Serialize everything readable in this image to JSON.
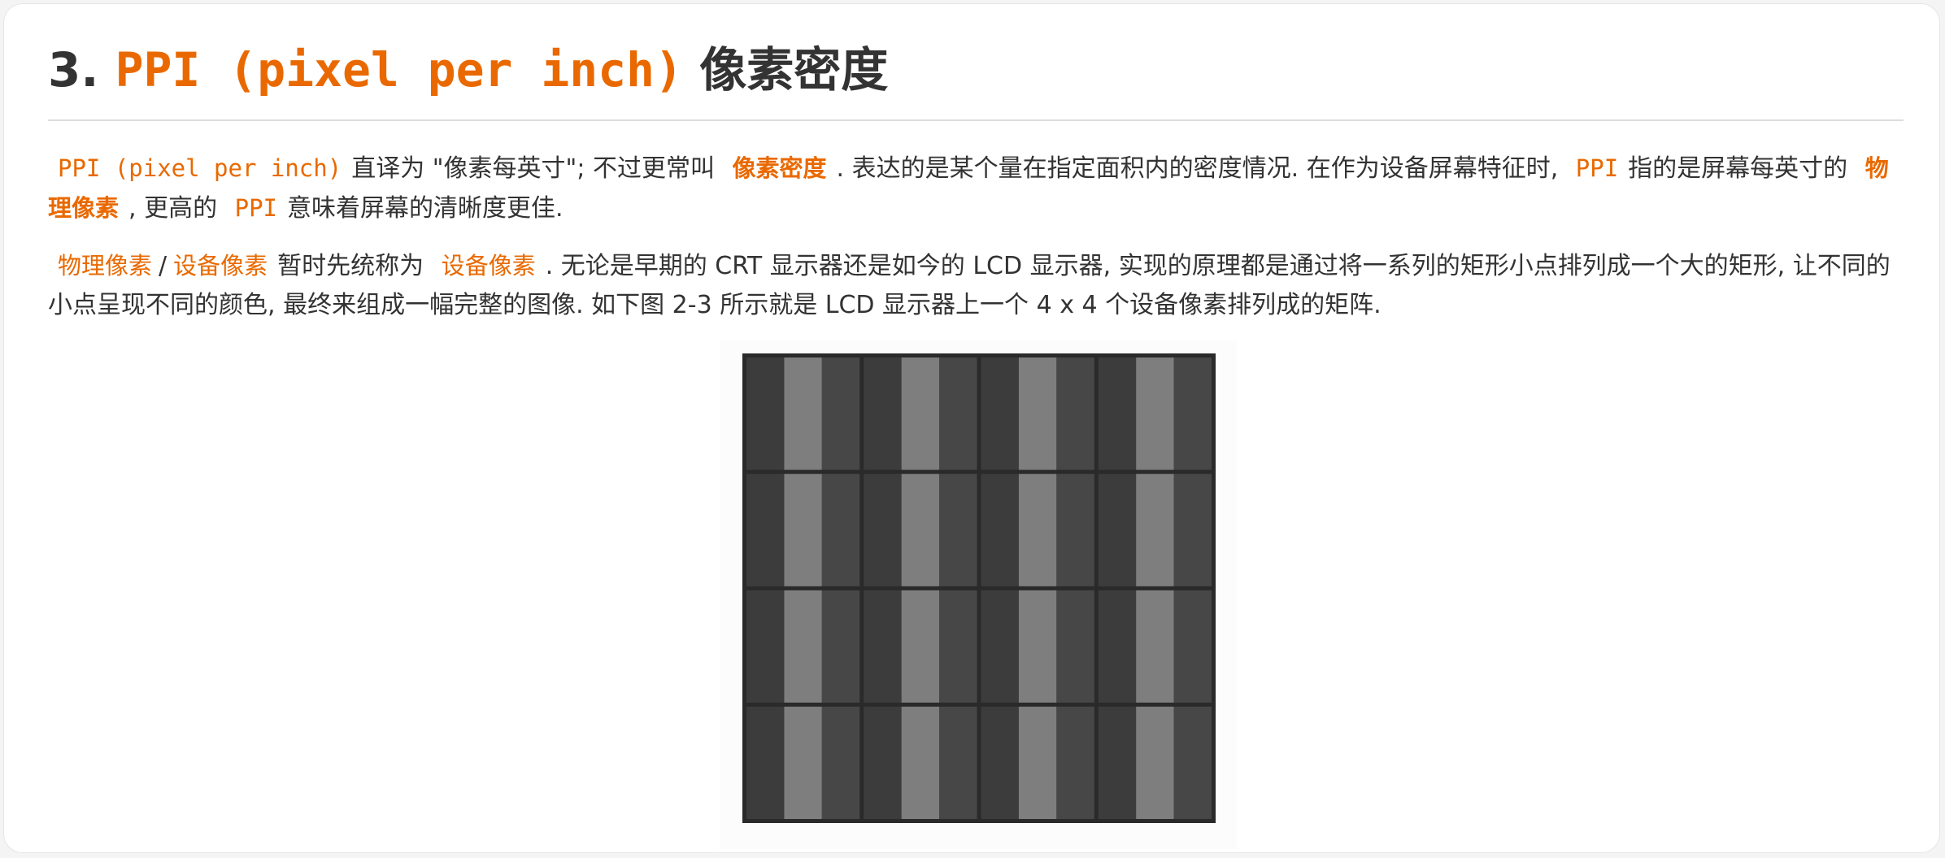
{
  "section": {
    "number": "3.",
    "title_code": "PPI (pixel per inch)",
    "title_text": "像素密度"
  },
  "paragraph1": {
    "code_ppi_full": "PPI (pixel per inch)",
    "t1": "直译为 \"像素每英寸\"; 不过更常叫",
    "strong_density": "像素密度",
    "t2": ". 表达的是某个量在指定面积内的密度情况. 在作为设备屏幕特征时,",
    "code_ppi_1": "PPI",
    "t3": "指的是屏幕每英寸的",
    "strong_physical": "物理像素",
    "t4": ", 更高的",
    "code_ppi_2": "PPI",
    "t5": "意味着屏幕的清晰度更佳."
  },
  "paragraph2": {
    "term_physical": "物理像素",
    "slash": "/",
    "term_device": "设备像素",
    "t1": "暂时先统称为",
    "term_device_2": "设备像素",
    "t2": ". 无论是早期的 CRT 显示器还是如今的 LCD 显示器, 实现的原理都是通过将一系列的矩形小点排列成一个大的矩形, 让不同的小点呈现不同的颜色, 最终来组成一幅完整的图像. 如下图 2-3 所示就是 LCD 显示器上一个 4 x 4 个设备像素排列成的矩阵."
  },
  "figure": {
    "rows": 4,
    "cols": 4,
    "colors": {
      "border": "#2a2a2a",
      "cell_dark": "#3c3c3c",
      "cell_mid": "#474747",
      "subpixel_light": "#7e7e7e"
    }
  },
  "colors": {
    "accent": "#e96900",
    "text": "#333333"
  }
}
